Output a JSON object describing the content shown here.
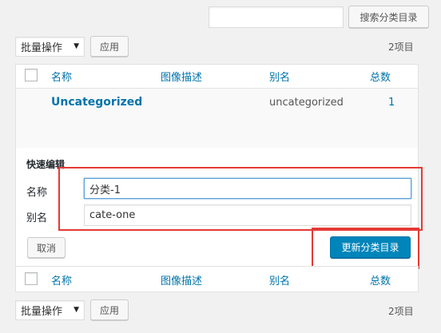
{
  "search": {
    "input_value": "",
    "button_label": "搜索分类目录"
  },
  "bulk_top": {
    "select_value": "批量操作",
    "apply_label": "应用",
    "items_count": "2项目"
  },
  "table": {
    "columns": {
      "name": "名称",
      "description": "图像描述",
      "slug": "别名",
      "count": "总数"
    },
    "rows": [
      {
        "name": "Uncategorized",
        "slug": "uncategorized",
        "count": "1"
      }
    ]
  },
  "quick_edit": {
    "title": "快速编辑",
    "name_label": "名称",
    "name_value": "分类-1",
    "slug_label": "别名",
    "slug_value": "cate-one",
    "cancel_label": "取消",
    "update_label": "更新分类目录"
  },
  "bulk_bottom": {
    "select_value": "批量操作",
    "apply_label": "应用",
    "items_count": "2项目"
  },
  "colors": {
    "link": "#0073aa",
    "primary": "#0085ba",
    "highlight": "#e53935"
  }
}
